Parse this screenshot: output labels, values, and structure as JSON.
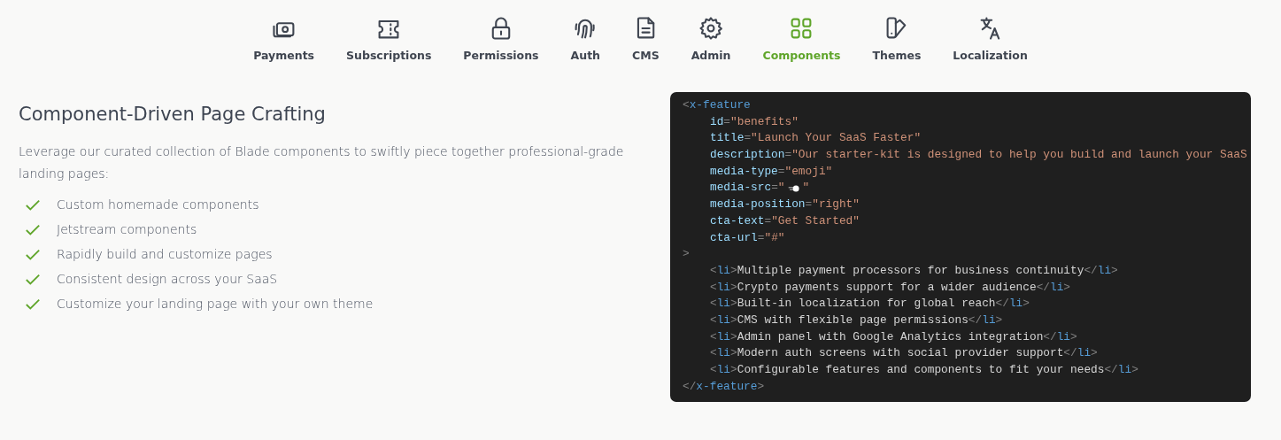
{
  "tabs": [
    {
      "label": "Payments",
      "selected": false
    },
    {
      "label": "Subscriptions",
      "selected": false
    },
    {
      "label": "Permissions",
      "selected": false
    },
    {
      "label": "Auth",
      "selected": false
    },
    {
      "label": "CMS",
      "selected": false
    },
    {
      "label": "Admin",
      "selected": false
    },
    {
      "label": "Components",
      "selected": true
    },
    {
      "label": "Themes",
      "selected": false
    },
    {
      "label": "Localization",
      "selected": false
    }
  ],
  "feature": {
    "heading": "Component-Driven Page Crafting",
    "description": "Leverage our curated collection of Blade components to swiftly piece together professional-grade landing pages:",
    "points": [
      "Custom homemade components",
      "Jetstream components",
      "Rapidly build and customize pages",
      "Consistent design across your SaaS",
      "Customize your landing page with your own theme"
    ]
  },
  "code": {
    "lines": [
      {
        "indented": false,
        "segments": [
          {
            "kind": "punct",
            "text": "<"
          },
          {
            "kind": "tag",
            "text": "x-feature"
          }
        ]
      },
      {
        "indented": true,
        "segments": [
          {
            "kind": "attr",
            "text": "id"
          },
          {
            "kind": "punct",
            "text": "="
          },
          {
            "kind": "str",
            "text": "\"benefits\""
          }
        ]
      },
      {
        "indented": true,
        "segments": [
          {
            "kind": "attr",
            "text": "title"
          },
          {
            "kind": "punct",
            "text": "="
          },
          {
            "kind": "str",
            "text": "\"Launch Your SaaS Faster\""
          }
        ]
      },
      {
        "indented": true,
        "segments": [
          {
            "kind": "attr",
            "text": "description"
          },
          {
            "kind": "punct",
            "text": "="
          },
          {
            "kind": "str",
            "text": "\"Our starter-kit is designed to help you build and launch your SaaS"
          }
        ]
      },
      {
        "indented": true,
        "segments": [
          {
            "kind": "attr",
            "text": "media-type"
          },
          {
            "kind": "punct",
            "text": "="
          },
          {
            "kind": "str",
            "text": "\"emoji\""
          }
        ]
      },
      {
        "indented": true,
        "segments": [
          {
            "kind": "attr",
            "text": "media-src"
          },
          {
            "kind": "punct",
            "text": "="
          },
          {
            "kind": "str",
            "text": "\""
          },
          {
            "kind": "icon"
          },
          {
            "kind": "str",
            "text": "\""
          }
        ]
      },
      {
        "indented": true,
        "segments": [
          {
            "kind": "attr",
            "text": "media-position"
          },
          {
            "kind": "punct",
            "text": "="
          },
          {
            "kind": "str",
            "text": "\"right\""
          }
        ]
      },
      {
        "indented": true,
        "segments": [
          {
            "kind": "attr",
            "text": "cta-text"
          },
          {
            "kind": "punct",
            "text": "="
          },
          {
            "kind": "str",
            "text": "\"Get Started\""
          }
        ]
      },
      {
        "indented": true,
        "segments": [
          {
            "kind": "attr",
            "text": "cta-url"
          },
          {
            "kind": "punct",
            "text": "="
          },
          {
            "kind": "str",
            "text": "\"#\""
          }
        ]
      },
      {
        "indented": false,
        "segments": [
          {
            "kind": "punct",
            "text": ">"
          }
        ]
      },
      {
        "indented": true,
        "segments": [
          {
            "kind": "punct",
            "text": "<"
          },
          {
            "kind": "tag",
            "text": "li"
          },
          {
            "kind": "punct",
            "text": ">"
          },
          {
            "kind": "text",
            "text": "Multiple payment processors for business continuity"
          },
          {
            "kind": "punct",
            "text": "</"
          },
          {
            "kind": "tag",
            "text": "li"
          },
          {
            "kind": "punct",
            "text": ">"
          }
        ]
      },
      {
        "indented": true,
        "segments": [
          {
            "kind": "punct",
            "text": "<"
          },
          {
            "kind": "tag",
            "text": "li"
          },
          {
            "kind": "punct",
            "text": ">"
          },
          {
            "kind": "text",
            "text": "Crypto payments support for a wider audience"
          },
          {
            "kind": "punct",
            "text": "</"
          },
          {
            "kind": "tag",
            "text": "li"
          },
          {
            "kind": "punct",
            "text": ">"
          }
        ]
      },
      {
        "indented": true,
        "segments": [
          {
            "kind": "punct",
            "text": "<"
          },
          {
            "kind": "tag",
            "text": "li"
          },
          {
            "kind": "punct",
            "text": ">"
          },
          {
            "kind": "text",
            "text": "Built-in localization for global reach"
          },
          {
            "kind": "punct",
            "text": "</"
          },
          {
            "kind": "tag",
            "text": "li"
          },
          {
            "kind": "punct",
            "text": ">"
          }
        ]
      },
      {
        "indented": true,
        "segments": [
          {
            "kind": "punct",
            "text": "<"
          },
          {
            "kind": "tag",
            "text": "li"
          },
          {
            "kind": "punct",
            "text": ">"
          },
          {
            "kind": "text",
            "text": "CMS with flexible page permissions"
          },
          {
            "kind": "punct",
            "text": "</"
          },
          {
            "kind": "tag",
            "text": "li"
          },
          {
            "kind": "punct",
            "text": ">"
          }
        ]
      },
      {
        "indented": true,
        "segments": [
          {
            "kind": "punct",
            "text": "<"
          },
          {
            "kind": "tag",
            "text": "li"
          },
          {
            "kind": "punct",
            "text": ">"
          },
          {
            "kind": "text",
            "text": "Admin panel with Google Analytics integration"
          },
          {
            "kind": "punct",
            "text": "</"
          },
          {
            "kind": "tag",
            "text": "li"
          },
          {
            "kind": "punct",
            "text": ">"
          }
        ]
      },
      {
        "indented": true,
        "segments": [
          {
            "kind": "punct",
            "text": "<"
          },
          {
            "kind": "tag",
            "text": "li"
          },
          {
            "kind": "punct",
            "text": ">"
          },
          {
            "kind": "text",
            "text": "Modern auth screens with social provider support"
          },
          {
            "kind": "punct",
            "text": "</"
          },
          {
            "kind": "tag",
            "text": "li"
          },
          {
            "kind": "punct",
            "text": ">"
          }
        ]
      },
      {
        "indented": true,
        "segments": [
          {
            "kind": "punct",
            "text": "<"
          },
          {
            "kind": "tag",
            "text": "li"
          },
          {
            "kind": "punct",
            "text": ">"
          },
          {
            "kind": "text",
            "text": "Configurable features and components to fit your needs"
          },
          {
            "kind": "punct",
            "text": "</"
          },
          {
            "kind": "tag",
            "text": "li"
          },
          {
            "kind": "punct",
            "text": ">"
          }
        ]
      },
      {
        "indented": false,
        "segments": [
          {
            "kind": "punct",
            "text": "</"
          },
          {
            "kind": "tag",
            "text": "x-feature"
          },
          {
            "kind": "punct",
            "text": ">"
          }
        ]
      }
    ]
  }
}
